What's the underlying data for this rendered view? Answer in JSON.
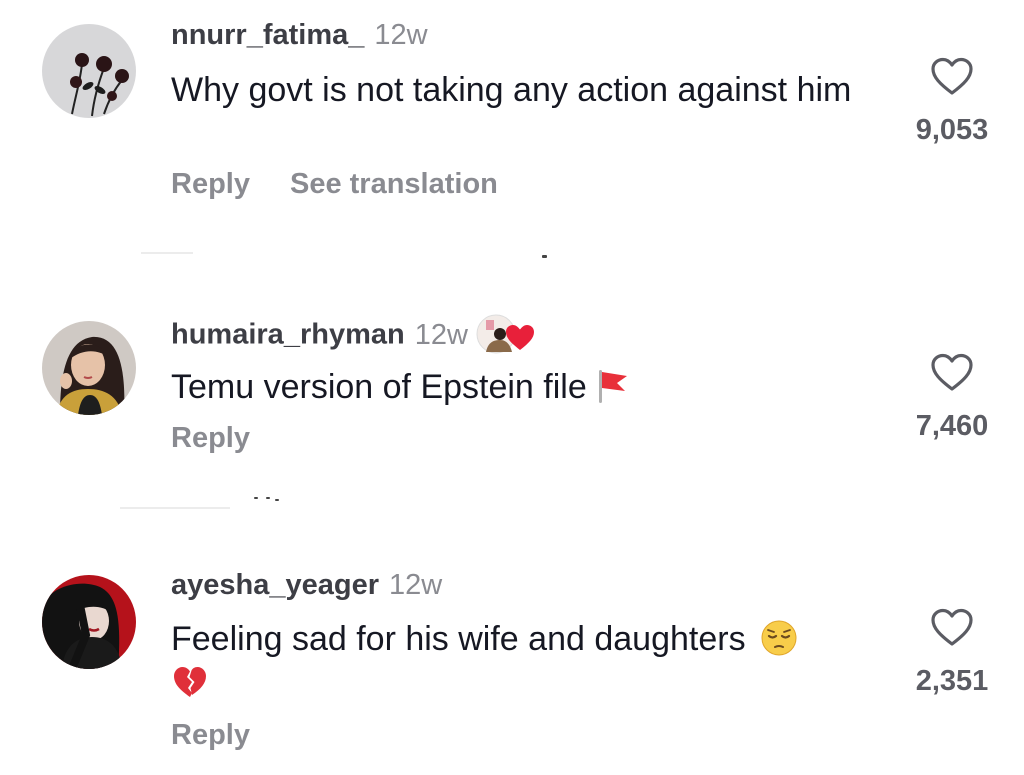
{
  "comments": [
    {
      "username": "nnurr_fatima_",
      "time": "12w",
      "text": "Why govt is not taking any action against him",
      "reply_label": "Reply",
      "translate_label": "See translation",
      "likes": "9,053",
      "avatar_icon": "roses-avatar-icon"
    },
    {
      "username": "humaira_rhyman",
      "time": "12w",
      "text": "Temu version of Epstein file",
      "emoji": "red-flag-emoji",
      "badge": "couple-heart-badge-icon",
      "reply_label": "Reply",
      "likes": "7,460",
      "avatar_icon": "woman-avatar-icon"
    },
    {
      "username": "ayesha_yeager",
      "time": "12w",
      "text": "Feeling sad for his wife and daughters",
      "emoji": "pensive-face-emoji",
      "emoji2": "broken-heart-emoji",
      "reply_label": "Reply",
      "likes": "2,351",
      "avatar_icon": "dark-hair-avatar-icon"
    }
  ],
  "colors": {
    "username": "#3d3e45",
    "meta": "#8a8b91",
    "text": "#161823",
    "heart_outline": "#5b5c63"
  }
}
